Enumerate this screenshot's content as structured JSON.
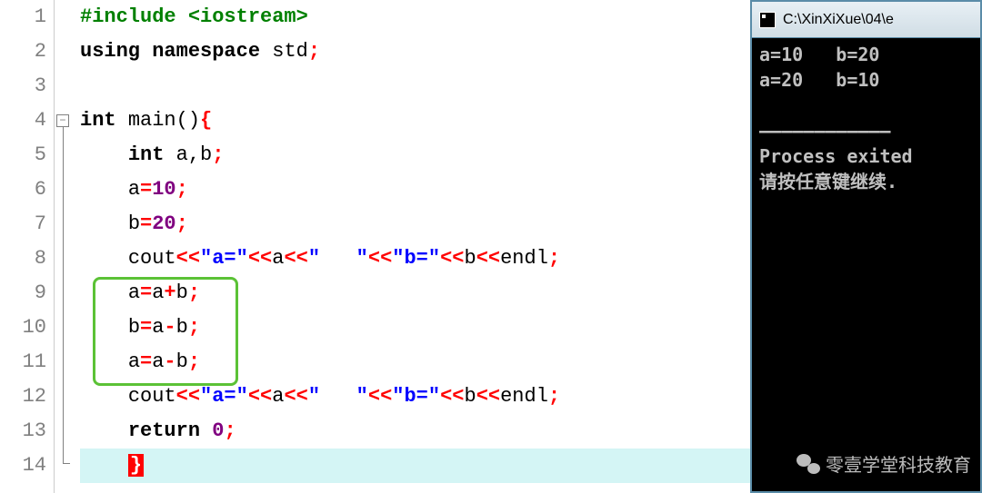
{
  "lines": [
    "1",
    "2",
    "3",
    "4",
    "5",
    "6",
    "7",
    "8",
    "9",
    "10",
    "11",
    "12",
    "13",
    "14"
  ],
  "code": {
    "l1": {
      "preproc": "#include <iostream>"
    },
    "l2": {
      "kw1": "using",
      "sp1": " ",
      "kw2": "namespace",
      "sp2": " ",
      "id": "std",
      "semi": ";"
    },
    "l4": {
      "kw": "int",
      "sp": " ",
      "id": "main",
      "paren": "()",
      "brace": "{"
    },
    "l5": {
      "indent": "    ",
      "kw": "int",
      "sp": " ",
      "id": "a",
      "punct": ",",
      "id2": "b",
      "semi": ";"
    },
    "l6": {
      "indent": "    ",
      "id": "a",
      "op": "=",
      "num": "10",
      "semi": ";"
    },
    "l7": {
      "indent": "    ",
      "id": "b",
      "op": "=",
      "num": "20",
      "semi": ";"
    },
    "l8": {
      "indent": "    ",
      "id1": "cout",
      "op1": "<<",
      "str1": "\"a=\"",
      "op2": "<<",
      "id2": "a",
      "op3": "<<",
      "str2": "\"   \"",
      "op4": "<<",
      "str3": "\"b=\"",
      "op5": "<<",
      "id3": "b",
      "op6": "<<",
      "id4": "endl",
      "semi": ";"
    },
    "l9": {
      "indent": "    ",
      "id1": "a",
      "op1": "=",
      "id2": "a",
      "op2": "+",
      "id3": "b",
      "semi": ";"
    },
    "l10": {
      "indent": "    ",
      "id1": "b",
      "op1": "=",
      "id2": "a",
      "op2": "-",
      "id3": "b",
      "semi": ";"
    },
    "l11": {
      "indent": "    ",
      "id1": "a",
      "op1": "=",
      "id2": "a",
      "op2": "-",
      "id3": "b",
      "semi": ";"
    },
    "l12": {
      "indent": "    ",
      "id1": "cout",
      "op1": "<<",
      "str1": "\"a=\"",
      "op2": "<<",
      "id2": "a",
      "op3": "<<",
      "str2": "\"   \"",
      "op4": "<<",
      "str3": "\"b=\"",
      "op5": "<<",
      "id3": "b",
      "op6": "<<",
      "id4": "endl",
      "semi": ";"
    },
    "l13": {
      "indent": "    ",
      "kw": "return",
      "sp": " ",
      "num": "0",
      "semi": ";"
    },
    "l14": {
      "indent": "    ",
      "brace": "}"
    }
  },
  "console": {
    "title": "C:\\XinXiXue\\04\\e",
    "out1": "a=10   b=20",
    "out2": "a=20   b=10",
    "divider": "————————————",
    "exit": "Process exited",
    "prompt": "请按任意键继续."
  },
  "watermark": "零壹学堂科技教育"
}
